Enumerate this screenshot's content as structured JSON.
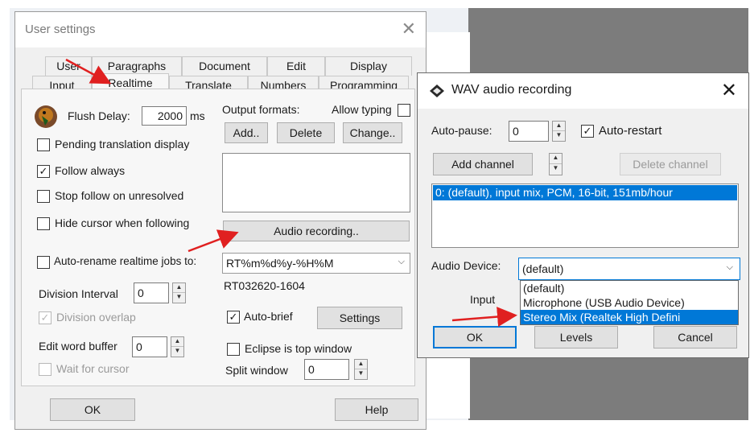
{
  "user_settings": {
    "title": "User settings",
    "close": "✕",
    "tabs_row1": [
      "User",
      "Paragraphs",
      "Document",
      "Edit",
      "Display"
    ],
    "tabs_row2": [
      "Input",
      "Realtime",
      "Translate",
      "Numbers",
      "Programming"
    ],
    "active_tab": "Realtime",
    "flush_delay_label": "Flush Delay:",
    "flush_delay_value": "2000",
    "flush_delay_unit": "ms",
    "output_formats_label": "Output formats:",
    "allow_typing_label": "Allow typing",
    "add_button": "Add..",
    "delete_button": "Delete",
    "change_button": "Change..",
    "pending_translation": "Pending translation display",
    "follow_always": "Follow always",
    "stop_follow": "Stop follow on unresolved",
    "hide_cursor": "Hide cursor when following",
    "audio_recording_button": "Audio recording..",
    "auto_rename_label": "Auto-rename realtime jobs to:",
    "auto_rename_value": "RT%m%d%y-%H%M",
    "auto_rename_preview": "RT032620-1604",
    "division_interval_label": "Division Interval",
    "division_interval_value": "0",
    "division_overlap": "Division overlap",
    "auto_brief": "Auto-brief",
    "settings_button": "Settings",
    "edit_word_buffer_label": "Edit word buffer",
    "edit_word_buffer_value": "0",
    "eclipse_top": "Eclipse is top window",
    "wait_for_cursor": "Wait for cursor",
    "split_window_label": "Split window",
    "split_window_value": "0",
    "ok_button": "OK",
    "help_button": "Help"
  },
  "wav": {
    "title": "WAV audio recording",
    "close": "✕",
    "auto_pause_label": "Auto-pause:",
    "auto_pause_value": "0",
    "auto_restart_label": "Auto-restart",
    "add_channel_button": "Add channel",
    "delete_channel_button": "Delete channel",
    "channels": [
      "0: (default), input mix, PCM, 16-bit, 151mb/hour"
    ],
    "audio_device_label": "Audio Device:",
    "audio_device_value": "(default)",
    "input_label": "Input",
    "device_options": [
      "(default)",
      "Microphone (USB Audio Device)",
      "Stereo Mix (Realtek High Defini"
    ],
    "selected_option_index": 2,
    "ok_button": "OK",
    "levels_button": "Levels",
    "cancel_button": "Cancel"
  },
  "colors": {
    "highlight": "#0078d7",
    "arrow": "#e02020"
  }
}
